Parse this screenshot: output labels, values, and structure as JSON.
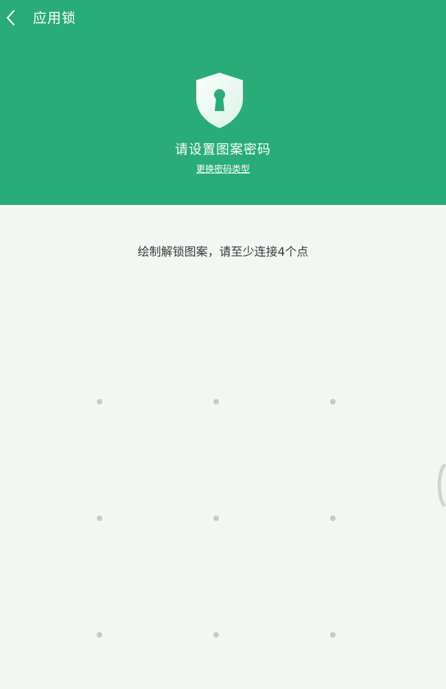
{
  "header": {
    "title": "应用锁",
    "back_icon": "chevron-left-icon",
    "shield_icon": "shield-keyhole-icon",
    "prompt": "请设置图案密码",
    "change_type_link": "更换密码类型",
    "color": "#2aac78"
  },
  "main": {
    "instruction": "绘制解锁图案，请至少连接4个点",
    "background_color": "#f2f7f4",
    "pattern": {
      "rows": 3,
      "columns": 3,
      "dot_color": "#c6c9c7"
    }
  },
  "edge_handle_icon": "edge-handle-icon"
}
